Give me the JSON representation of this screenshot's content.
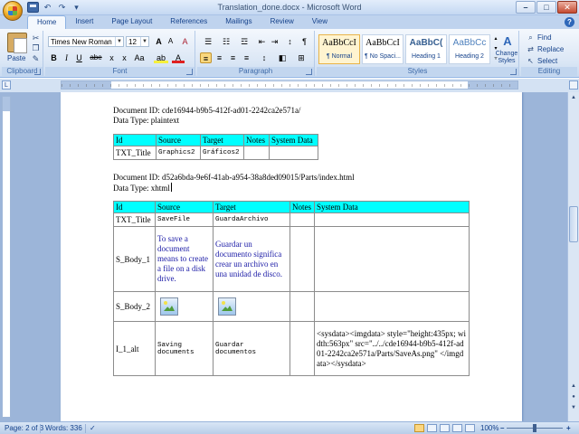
{
  "window": {
    "title": "Translation_done.docx - Microsoft Word",
    "minimize": "–",
    "maximize": "□",
    "close": "✕"
  },
  "tabs": [
    {
      "label": "Home"
    },
    {
      "label": "Insert"
    },
    {
      "label": "Page Layout"
    },
    {
      "label": "References"
    },
    {
      "label": "Mailings"
    },
    {
      "label": "Review"
    },
    {
      "label": "View"
    }
  ],
  "ribbon": {
    "clipboard": {
      "label": "Clipboard",
      "paste": "Paste"
    },
    "font": {
      "label": "Font",
      "name": "Times New Roman",
      "size": "12",
      "grow": "A",
      "shrink": "A",
      "clear": "A",
      "bold": "B",
      "italic": "I",
      "underline": "U",
      "strike": "abe",
      "subscript": "x",
      "superscript": "x",
      "case": "Aa",
      "highlight": "ab",
      "color": "A"
    },
    "paragraph": {
      "label": "Paragraph",
      "show": "¶"
    },
    "styles": {
      "label": "Styles",
      "items": [
        {
          "sample": "AaBbCcI",
          "name": "¶ Normal"
        },
        {
          "sample": "AaBbCcI",
          "name": "¶ No Spaci..."
        },
        {
          "sample": "AaBbC(",
          "name": "Heading 1"
        },
        {
          "sample": "AaBbCc",
          "name": "Heading 2"
        }
      ],
      "change": "Change Styles"
    },
    "editing": {
      "label": "Editing",
      "find": "Find",
      "replace": "Replace",
      "select": "Select"
    }
  },
  "document": {
    "block1": {
      "docid": "Document ID: cde16944-b9b5-412f-ad01-2242ca2e571a/",
      "dtype": "Data Type: plaintext",
      "headers": [
        "Id",
        "Source",
        "Target",
        "Notes",
        "System Data"
      ],
      "row": [
        "TXT_Title",
        "Graphics2",
        "Gráficos2",
        "",
        ""
      ]
    },
    "block2": {
      "docid": "Document ID: d52a6bda-9e6f-41ab-a954-38a8ded09015/Parts/index.html",
      "dtype": "Data Type: xhtml",
      "headers": [
        "Id",
        "Source",
        "Target",
        "Notes",
        "System Data"
      ],
      "rows": [
        {
          "id": "TXT_Title",
          "source": "SaveFile",
          "target": "GuardaArchivo"
        },
        {
          "id": "S_Body_1",
          "source": "To save a document means to create a file on a disk drive.",
          "target": "Guardar un documento significa crear un archivo en una unidad de disco."
        },
        {
          "id": "S_Body_2"
        },
        {
          "id": "I_1_alt",
          "source": "Saving documents",
          "target": "Guardar documentos",
          "sysdata": "<sysdata><imgdata> style=\"height:435px; width:563px\" src=\"../../cde16944-b9b5-412f-ad01-2242ca2e571a/Parts/SaveAs.png\" </imgdata></sysdata>"
        }
      ]
    }
  },
  "status": {
    "page": "Page: 2 of 3",
    "words": "Words: 336",
    "zoom": "100%",
    "zoom_out": "–",
    "zoom_in": "+"
  }
}
